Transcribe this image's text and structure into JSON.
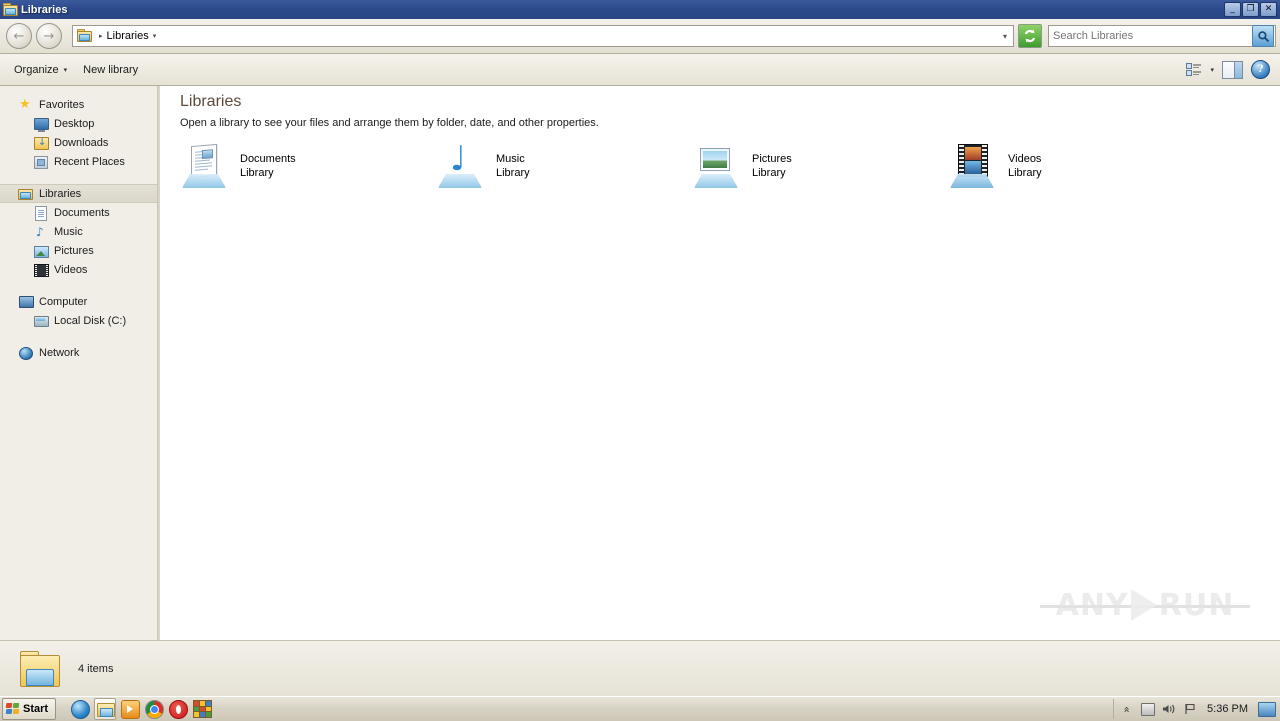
{
  "window": {
    "title": "Libraries",
    "icon": "libraries-folder-icon",
    "controls": {
      "minimize": "_",
      "maximize": "❐",
      "close": "✕"
    }
  },
  "address_bar": {
    "back_label": "←",
    "forward_label": "→",
    "breadcrumb_icon": "libraries-folder-icon",
    "breadcrumb_separator": "▸",
    "breadcrumb": "Libraries",
    "breadcrumb_dropdown": "▾",
    "path_dropdown": "▾",
    "refresh_icon": "refresh-icon",
    "search": {
      "value": "",
      "placeholder": "Search Libraries",
      "icon": "search-icon"
    }
  },
  "toolbar": {
    "organize_label": "Organize",
    "organize_caret": "▾",
    "new_library_label": "New library",
    "view_icon": "change-view-icon",
    "view_caret": "▾",
    "preview_pane_icon": "preview-pane-icon",
    "help_icon": "help-icon",
    "help_glyph": "?"
  },
  "sidebar": {
    "groups": [
      {
        "header": {
          "label": "Favorites",
          "icon": "star-icon"
        },
        "items": [
          {
            "label": "Desktop",
            "icon": "desktop-icon"
          },
          {
            "label": "Downloads",
            "icon": "downloads-icon"
          },
          {
            "label": "Recent Places",
            "icon": "recent-places-icon"
          }
        ]
      },
      {
        "header": {
          "label": "Libraries",
          "icon": "libraries-icon",
          "selected": true
        },
        "items": [
          {
            "label": "Documents",
            "icon": "document-icon"
          },
          {
            "label": "Music",
            "icon": "music-note-icon"
          },
          {
            "label": "Pictures",
            "icon": "picture-icon"
          },
          {
            "label": "Videos",
            "icon": "film-icon"
          }
        ]
      },
      {
        "header": {
          "label": "Computer",
          "icon": "computer-icon"
        },
        "items": [
          {
            "label": "Local Disk (C:)",
            "icon": "hard-disk-icon"
          }
        ]
      },
      {
        "header": {
          "label": "Network",
          "icon": "network-icon"
        },
        "items": []
      }
    ]
  },
  "main": {
    "title": "Libraries",
    "subtitle": "Open a library to see your files and arrange them by folder, date, and other properties.",
    "items": [
      {
        "name": "Documents",
        "type": "Library",
        "icon": "documents-library-icon"
      },
      {
        "name": "Music",
        "type": "Library",
        "icon": "music-library-icon"
      },
      {
        "name": "Pictures",
        "type": "Library",
        "icon": "pictures-library-icon"
      },
      {
        "name": "Videos",
        "type": "Library",
        "icon": "videos-library-icon"
      }
    ],
    "watermark": {
      "left": "ANY",
      "right": "RUN"
    }
  },
  "status_bar": {
    "icon": "libraries-folder-icon",
    "text": "4 items"
  },
  "taskbar": {
    "start_label": "Start",
    "quick_launch": [
      {
        "name": "internet-explorer-icon"
      },
      {
        "name": "windows-explorer-icon",
        "active": true
      },
      {
        "name": "media-player-icon"
      },
      {
        "name": "chrome-icon"
      },
      {
        "name": "opera-icon"
      },
      {
        "name": "app-icon"
      }
    ],
    "tray": {
      "chevron": "«",
      "network_icon": "network-tray-icon",
      "volume_icon": "volume-icon",
      "volume_glyph": "◂))",
      "flag_icon": "action-center-flag-icon",
      "time": "5:36 PM",
      "show_desktop_icon": "show-desktop-icon"
    }
  }
}
